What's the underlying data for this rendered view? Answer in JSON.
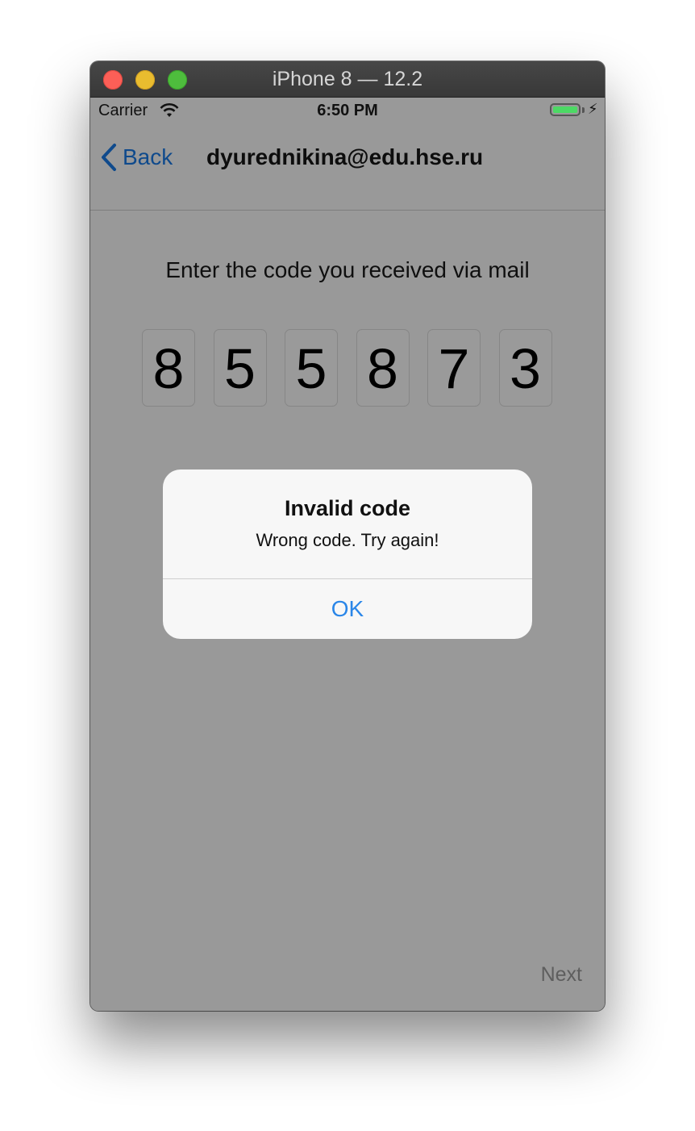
{
  "window": {
    "title": "iPhone 8 — 12.2"
  },
  "status_bar": {
    "carrier": "Carrier",
    "time": "6:50 PM",
    "charging_glyph": "⚡",
    "battery_color": "#4cd964"
  },
  "nav": {
    "back_label": "Back",
    "title": "dyurednikina@edu.hse.ru"
  },
  "main": {
    "prompt": "Enter the code you received via mail",
    "code_digits": [
      "8",
      "5",
      "5",
      "8",
      "7",
      "3"
    ],
    "next_label": "Next"
  },
  "alert": {
    "title": "Invalid code",
    "message": "Wrong code. Try again!",
    "ok_label": "OK",
    "ok_color": "#2a86e8"
  },
  "colors": {
    "overlay": "#999999",
    "alert_bg": "#f7f7f7"
  }
}
